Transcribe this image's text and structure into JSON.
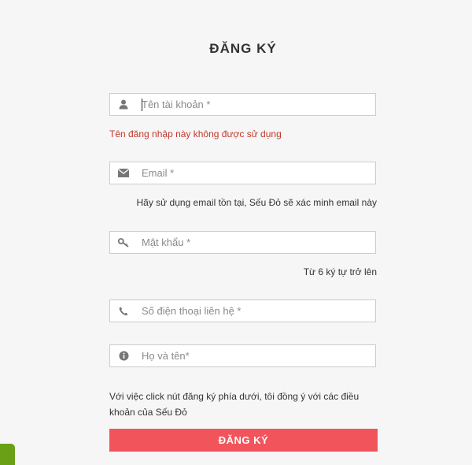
{
  "form": {
    "title": "ĐĂNG KÝ",
    "username": {
      "placeholder": "Tên tài khoản *",
      "icon": "user-icon",
      "error": "Tên đăng nhập này không được sử dụng"
    },
    "email": {
      "placeholder": "Email *",
      "icon": "envelope-icon",
      "hint": "Hãy sử dụng email tồn tại, Sếu Đỏ sẽ xác minh email này"
    },
    "password": {
      "placeholder": "Mật khẩu *",
      "icon": "key-icon",
      "hint": "Từ 6 ký tự trở lên"
    },
    "phone": {
      "placeholder": "Số điện thoại liên hệ *",
      "icon": "phone-icon"
    },
    "fullname": {
      "placeholder": "Họ và tên*",
      "icon": "info-icon"
    },
    "terms": "Với việc click nút đăng ký phía dưới, tôi đồng ý với các điều khoản của Sếu Đỏ",
    "submit_label": "ĐĂNG KÝ"
  },
  "colors": {
    "background": "#f6f6f6",
    "error": "#c0392b",
    "submit": "#f2545b",
    "corner_tab": "#6aa016"
  }
}
